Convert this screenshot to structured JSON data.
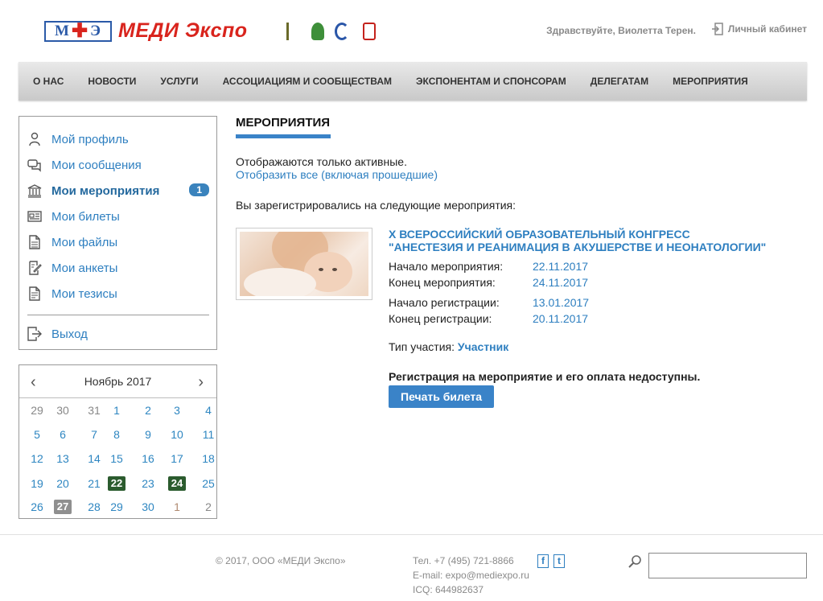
{
  "header": {
    "logo_box": "М✚Э",
    "logo_box_left": "М",
    "logo_box_right": "Э",
    "logo_text": "МЕДИ Экспо",
    "greeting": "Здравствуйте, Виолетта Терен.",
    "cabinet": "Личный кабинет",
    "partner_icons": [
      "ufi-logo",
      "green-logo",
      "blue-logo",
      "red-logo"
    ]
  },
  "nav": [
    "О НАС",
    "НОВОСТИ",
    "УСЛУГИ",
    "АССОЦИАЦИЯМ И СООБЩЕСТВАМ",
    "ЭКСПОНЕНТАМ И СПОНСОРАМ",
    "ДЕЛЕГАТАМ",
    "МЕРОПРИЯТИЯ"
  ],
  "sidebar": {
    "items": [
      {
        "label": "Мой профиль",
        "icon": "user-icon"
      },
      {
        "label": "Мои сообщения",
        "icon": "messages-icon"
      },
      {
        "label": "Мои мероприятия",
        "icon": "building-icon",
        "badge": "1",
        "active": true
      },
      {
        "label": "Мои билеты",
        "icon": "ticket-icon"
      },
      {
        "label": "Мои файлы",
        "icon": "file-icon"
      },
      {
        "label": "Мои анкеты",
        "icon": "form-icon"
      },
      {
        "label": "Мои тезисы",
        "icon": "document-icon"
      }
    ],
    "logout": "Выход"
  },
  "calendar": {
    "month": "Ноябрь 2017",
    "weeks": [
      [
        "29",
        "30",
        "31",
        "1",
        "2",
        "3",
        "4"
      ],
      [
        "5",
        "6",
        "7",
        "8",
        "9",
        "10",
        "11"
      ],
      [
        "12",
        "13",
        "14",
        "15",
        "16",
        "17",
        "18"
      ],
      [
        "19",
        "20",
        "21",
        "22",
        "23",
        "24",
        "25"
      ],
      [
        "26",
        "27",
        "28",
        "29",
        "30",
        "1",
        "2"
      ]
    ]
  },
  "main": {
    "title": "МЕРОПРИЯТИЯ",
    "active_only": "Отображаются только активные.",
    "show_all": "Отобразить все (включая прошедшие)",
    "registered_for": "Вы зарегистрировались на следующие мероприятия:",
    "event": {
      "title_line1": "X ВСЕРОССИЙСКИЙ ОБРАЗОВАТЕЛЬНЫЙ КОНГРЕСС",
      "title_line2": "\"АНЕСТЕЗИЯ И РЕАНИМАЦИЯ В АКУШЕРСТВЕ И НЕОНАТОЛОГИИ\"",
      "start_label": "Начало мероприятия:",
      "start": "22.11.2017",
      "end_label": "Конец мероприятия:",
      "end": "24.11.2017",
      "reg_start_label": "Начало регистрации:",
      "reg_start": "13.01.2017",
      "reg_end_label": "Конец регистрации:",
      "reg_end": "20.11.2017",
      "type_label": "Тип участия:",
      "type": "Участник",
      "unavailable": "Регистрация на мероприятие и его оплата недоступны.",
      "print_button": "Печать билета"
    }
  },
  "footer": {
    "copyright": "© 2017, ООО «МЕДИ Экспо»",
    "phone": "Тел. +7 (495) 721-8866",
    "email": "E-mail: expo@mediexpo.ru",
    "icq": "ICQ: 644982637",
    "facebook": "f",
    "twitter": "t"
  },
  "colors": {
    "accent": "#3a83c8",
    "link": "#2e7fc0",
    "brand_red": "#d9241d",
    "event_day": "#2b5b2e",
    "today": "#8f8f8f"
  }
}
